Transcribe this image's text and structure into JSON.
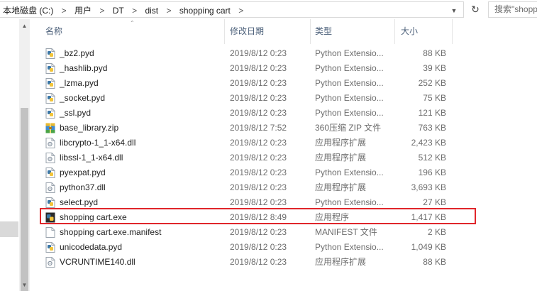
{
  "address": {
    "crumbs": [
      "本地磁盘 (C:)",
      "用户",
      "DT",
      "dist",
      "shopping cart"
    ],
    "separator": ">",
    "search_placeholder": "搜索\"shopp"
  },
  "columns": {
    "name": "名称",
    "date": "修改日期",
    "type": "类型",
    "size": "大小"
  },
  "files": [
    {
      "name": "_bz2.pyd",
      "date": "2019/8/12 0:23",
      "type": "Python Extensio...",
      "size": "88 KB",
      "icon": "python-extension-icon"
    },
    {
      "name": "_hashlib.pyd",
      "date": "2019/8/12 0:23",
      "type": "Python Extensio...",
      "size": "39 KB",
      "icon": "python-extension-icon"
    },
    {
      "name": "_lzma.pyd",
      "date": "2019/8/12 0:23",
      "type": "Python Extensio...",
      "size": "252 KB",
      "icon": "python-extension-icon"
    },
    {
      "name": "_socket.pyd",
      "date": "2019/8/12 0:23",
      "type": "Python Extensio...",
      "size": "75 KB",
      "icon": "python-extension-icon"
    },
    {
      "name": "_ssl.pyd",
      "date": "2019/8/12 0:23",
      "type": "Python Extensio...",
      "size": "121 KB",
      "icon": "python-extension-icon"
    },
    {
      "name": "base_library.zip",
      "date": "2019/8/12 7:52",
      "type": "360压缩 ZIP 文件",
      "size": "763 KB",
      "icon": "zip-archive-icon"
    },
    {
      "name": "libcrypto-1_1-x64.dll",
      "date": "2019/8/12 0:23",
      "type": "应用程序扩展",
      "size": "2,423 KB",
      "icon": "dll-file-icon"
    },
    {
      "name": "libssl-1_1-x64.dll",
      "date": "2019/8/12 0:23",
      "type": "应用程序扩展",
      "size": "512 KB",
      "icon": "dll-file-icon"
    },
    {
      "name": "pyexpat.pyd",
      "date": "2019/8/12 0:23",
      "type": "Python Extensio...",
      "size": "196 KB",
      "icon": "python-extension-icon"
    },
    {
      "name": "python37.dll",
      "date": "2019/8/12 0:23",
      "type": "应用程序扩展",
      "size": "3,693 KB",
      "icon": "dll-file-icon"
    },
    {
      "name": "select.pyd",
      "date": "2019/8/12 0:23",
      "type": "Python Extensio...",
      "size": "27 KB",
      "icon": "python-extension-icon"
    },
    {
      "name": "shopping cart.exe",
      "date": "2019/8/12 8:49",
      "type": "应用程序",
      "size": "1,417 KB",
      "icon": "python-exe-icon"
    },
    {
      "name": "shopping cart.exe.manifest",
      "date": "2019/8/12 0:23",
      "type": "MANIFEST 文件",
      "size": "2 KB",
      "icon": "blank-file-icon"
    },
    {
      "name": "unicodedata.pyd",
      "date": "2019/8/12 0:23",
      "type": "Python Extensio...",
      "size": "1,049 KB",
      "icon": "python-extension-icon"
    },
    {
      "name": "VCRUNTIME140.dll",
      "date": "2019/8/12 0:23",
      "type": "应用程序扩展",
      "size": "88 KB",
      "icon": "dll-file-icon"
    }
  ],
  "highlighted_file": "shopping cart.exe",
  "colors": {
    "highlight_border": "#e0262b",
    "header_text": "#4c607a",
    "secondary_text": "#6d6d6d"
  }
}
